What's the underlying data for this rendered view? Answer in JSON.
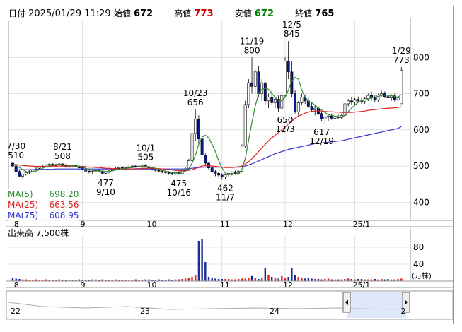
{
  "header": {
    "date_label": "日付",
    "datetime": "2025/01/29 11:29",
    "open_label": "始値",
    "open": "672",
    "high_label": "高値",
    "high": "773",
    "low_label": "安値",
    "low": "672",
    "close_label": "終値",
    "close": "765"
  },
  "colors": {
    "up": "#ffffff",
    "down": "#0a1a8c",
    "candle_outline": "#000000",
    "ma5": "#2e8b2e",
    "ma25": "#e02020",
    "ma75": "#3030d0",
    "vol_up": "#e02020",
    "vol_down": "#1a2a9c",
    "grid": "#cfcfcf"
  },
  "legend": {
    "ma5_label": "MA(5)",
    "ma5_value": "698.20",
    "ma25_label": "MA(25)",
    "ma25_value": "663.56",
    "ma75_label": "MA(75)",
    "ma75_value": "608.95"
  },
  "volume_title": "出来高  7,500株",
  "volume_unit": "(万株)",
  "navigator": {
    "labels": [
      "22",
      "23",
      "24",
      "2"
    ]
  },
  "chart_data": [
    {
      "type": "candlestick",
      "ylim": [
        350,
        900
      ],
      "yticks": [
        400,
        500,
        600,
        700,
        800
      ],
      "x_month_labels": [
        {
          "label": "8",
          "index": 1
        },
        {
          "label": "9",
          "index": 21
        },
        {
          "label": "10",
          "index": 41
        },
        {
          "label": "11",
          "index": 63
        },
        {
          "label": "12",
          "index": 82
        },
        {
          "label": "25/1",
          "index": 103
        }
      ],
      "annotations": [
        {
          "text": [
            "7/30",
            "510"
          ],
          "index": 1,
          "value": 510,
          "pos": "above"
        },
        {
          "text": [
            "8/21",
            "508"
          ],
          "index": 15,
          "value": 508,
          "pos": "above"
        },
        {
          "text": [
            "477",
            "9/10"
          ],
          "index": 28,
          "value": 477,
          "pos": "below"
        },
        {
          "text": [
            "10/1",
            "505"
          ],
          "index": 40,
          "value": 505,
          "pos": "above"
        },
        {
          "text": [
            "10/23",
            "656"
          ],
          "index": 55,
          "value": 656,
          "pos": "above"
        },
        {
          "text": [
            "475",
            "10/16"
          ],
          "index": 50,
          "value": 475,
          "pos": "below"
        },
        {
          "text": [
            "462",
            "11/7"
          ],
          "index": 64,
          "value": 462,
          "pos": "below"
        },
        {
          "text": [
            "11/19",
            "800"
          ],
          "index": 72,
          "value": 800,
          "pos": "above"
        },
        {
          "text": [
            "12/5",
            "845"
          ],
          "index": 84,
          "value": 845,
          "pos": "above"
        },
        {
          "text": [
            "650",
            "12/3"
          ],
          "index": 82,
          "value": 650,
          "pos": "below"
        },
        {
          "text": [
            "617",
            "12/19"
          ],
          "index": 93,
          "value": 617,
          "pos": "below"
        },
        {
          "text": [
            "1/29",
            "773"
          ],
          "index": 117,
          "value": 773,
          "pos": "above"
        }
      ],
      "ohlc": [
        [
          508,
          510,
          498,
          500
        ],
        [
          500,
          502,
          480,
          485
        ],
        [
          485,
          490,
          470,
          472
        ],
        [
          472,
          480,
          465,
          478
        ],
        [
          478,
          485,
          474,
          482
        ],
        [
          482,
          488,
          478,
          485
        ],
        [
          485,
          492,
          482,
          490
        ],
        [
          490,
          496,
          486,
          494
        ],
        [
          494,
          500,
          490,
          498
        ],
        [
          498,
          503,
          494,
          500
        ],
        [
          500,
          505,
          496,
          503
        ],
        [
          503,
          507,
          499,
          505
        ],
        [
          505,
          508,
          500,
          502
        ],
        [
          502,
          506,
          498,
          504
        ],
        [
          504,
          508,
          500,
          506
        ],
        [
          506,
          508,
          500,
          502
        ],
        [
          502,
          505,
          496,
          498
        ],
        [
          498,
          502,
          494,
          500
        ],
        [
          500,
          504,
          496,
          502
        ],
        [
          502,
          505,
          497,
          499
        ],
        [
          499,
          502,
          493,
          495
        ],
        [
          495,
          498,
          488,
          490
        ],
        [
          490,
          494,
          484,
          486
        ],
        [
          486,
          490,
          480,
          484
        ],
        [
          484,
          488,
          479,
          486
        ],
        [
          486,
          490,
          482,
          488
        ],
        [
          488,
          492,
          484,
          486
        ],
        [
          486,
          489,
          477,
          480
        ],
        [
          480,
          486,
          477,
          484
        ],
        [
          484,
          490,
          480,
          488
        ],
        [
          488,
          494,
          484,
          492
        ],
        [
          492,
          496,
          488,
          494
        ],
        [
          494,
          498,
          490,
          496
        ],
        [
          496,
          499,
          492,
          494
        ],
        [
          494,
          498,
          490,
          496
        ],
        [
          496,
          500,
          492,
          498
        ],
        [
          498,
          502,
          494,
          500
        ],
        [
          500,
          503,
          496,
          498
        ],
        [
          498,
          502,
          494,
          500
        ],
        [
          500,
          505,
          496,
          503
        ],
        [
          503,
          505,
          496,
          498
        ],
        [
          498,
          501,
          492,
          494
        ],
        [
          494,
          497,
          488,
          490
        ],
        [
          490,
          494,
          485,
          488
        ],
        [
          488,
          492,
          484,
          486
        ],
        [
          486,
          490,
          480,
          484
        ],
        [
          484,
          488,
          478,
          482
        ],
        [
          482,
          486,
          476,
          480
        ],
        [
          480,
          484,
          475,
          478
        ],
        [
          478,
          484,
          475,
          482
        ],
        [
          482,
          486,
          476,
          479
        ],
        [
          479,
          490,
          477,
          488
        ],
        [
          488,
          496,
          484,
          492
        ],
        [
          492,
          520,
          490,
          515
        ],
        [
          515,
          600,
          510,
          590
        ],
        [
          590,
          656,
          570,
          630
        ],
        [
          630,
          640,
          560,
          575
        ],
        [
          575,
          582,
          520,
          530
        ],
        [
          530,
          535,
          500,
          508
        ],
        [
          508,
          512,
          490,
          495
        ],
        [
          495,
          500,
          480,
          485
        ],
        [
          485,
          490,
          472,
          480
        ],
        [
          480,
          484,
          468,
          475
        ],
        [
          475,
          480,
          462,
          470
        ],
        [
          470,
          478,
          465,
          476
        ],
        [
          476,
          482,
          470,
          480
        ],
        [
          480,
          486,
          474,
          484
        ],
        [
          484,
          488,
          476,
          480
        ],
        [
          480,
          488,
          476,
          486
        ],
        [
          486,
          560,
          484,
          555
        ],
        [
          555,
          680,
          550,
          670
        ],
        [
          670,
          740,
          660,
          730
        ],
        [
          730,
          800,
          700,
          720
        ],
        [
          720,
          770,
          700,
          760
        ],
        [
          760,
          775,
          690,
          700
        ],
        [
          700,
          740,
          680,
          730
        ],
        [
          730,
          735,
          670,
          680
        ],
        [
          680,
          700,
          660,
          690
        ],
        [
          690,
          710,
          670,
          675
        ],
        [
          675,
          690,
          660,
          685
        ],
        [
          685,
          695,
          650,
          660
        ],
        [
          660,
          700,
          655,
          695
        ],
        [
          695,
          800,
          690,
          790
        ],
        [
          790,
          845,
          740,
          760
        ],
        [
          760,
          790,
          690,
          700
        ],
        [
          700,
          710,
          645,
          650
        ],
        [
          650,
          680,
          640,
          675
        ],
        [
          675,
          700,
          668,
          690
        ],
        [
          690,
          698,
          672,
          680
        ],
        [
          680,
          688,
          660,
          665
        ],
        [
          665,
          675,
          650,
          655
        ],
        [
          655,
          670,
          640,
          660
        ],
        [
          660,
          665,
          640,
          645
        ],
        [
          645,
          650,
          625,
          630
        ],
        [
          630,
          640,
          617,
          635
        ],
        [
          635,
          642,
          625,
          638
        ],
        [
          638,
          645,
          628,
          632
        ],
        [
          632,
          640,
          625,
          636
        ],
        [
          636,
          642,
          630,
          634
        ],
        [
          634,
          645,
          630,
          640
        ],
        [
          640,
          680,
          638,
          672
        ],
        [
          672,
          685,
          665,
          680
        ],
        [
          680,
          690,
          670,
          676
        ],
        [
          676,
          688,
          670,
          684
        ],
        [
          684,
          692,
          676,
          680
        ],
        [
          680,
          688,
          672,
          678
        ],
        [
          678,
          690,
          672,
          686
        ],
        [
          686,
          700,
          680,
          695
        ],
        [
          695,
          705,
          680,
          688
        ],
        [
          688,
          696,
          676,
          682
        ],
        [
          682,
          700,
          678,
          696
        ],
        [
          696,
          708,
          690,
          700
        ],
        [
          700,
          706,
          688,
          692
        ],
        [
          692,
          700,
          684,
          688
        ],
        [
          688,
          698,
          680,
          694
        ],
        [
          694,
          700,
          678,
          682
        ],
        [
          682,
          692,
          672,
          688
        ],
        [
          672,
          773,
          672,
          765
        ]
      ],
      "ma5": [
        505,
        502,
        496,
        490,
        485,
        482,
        484,
        486,
        490,
        494,
        498,
        501,
        503,
        504,
        504,
        504,
        503,
        502,
        501,
        500,
        499,
        497,
        494,
        491,
        488,
        487,
        487,
        486,
        485,
        485,
        487,
        489,
        491,
        493,
        494,
        495,
        496,
        497,
        498,
        499,
        499,
        498,
        496,
        494,
        491,
        488,
        486,
        484,
        482,
        481,
        481,
        483,
        486,
        493,
        508,
        530,
        560,
        580,
        585,
        578,
        560,
        540,
        515,
        495,
        480,
        477,
        477,
        478,
        480,
        490,
        520,
        570,
        620,
        665,
        700,
        712,
        715,
        712,
        700,
        690,
        682,
        680,
        690,
        710,
        735,
        745,
        740,
        710,
        690,
        680,
        675,
        668,
        660,
        655,
        648,
        642,
        640,
        638,
        636,
        635,
        640,
        650,
        660,
        668,
        676,
        680,
        682,
        685,
        688,
        690,
        692,
        695,
        696,
        695,
        694,
        692,
        690,
        698
      ],
      "ma25": [
        505,
        504,
        503,
        502,
        501,
        500,
        500,
        499,
        499,
        499,
        499,
        499,
        500,
        500,
        500,
        500,
        500,
        500,
        500,
        500,
        499,
        499,
        498,
        497,
        497,
        496,
        496,
        495,
        494,
        494,
        493,
        493,
        492,
        492,
        492,
        492,
        492,
        493,
        493,
        494,
        494,
        494,
        494,
        493,
        493,
        492,
        491,
        490,
        489,
        488,
        487,
        487,
        487,
        488,
        490,
        493,
        497,
        500,
        501,
        501,
        500,
        499,
        498,
        497,
        496,
        496,
        496,
        497,
        498,
        500,
        505,
        512,
        520,
        530,
        540,
        550,
        560,
        570,
        578,
        585,
        592,
        600,
        608,
        616,
        624,
        632,
        638,
        642,
        646,
        649,
        651,
        652,
        652,
        652,
        651,
        650,
        650,
        649,
        649,
        648,
        648,
        648,
        648,
        649,
        650,
        651,
        652,
        654,
        655,
        656,
        657,
        658,
        659,
        660,
        660,
        661,
        662,
        664
      ],
      "ma75": [
        490,
        490,
        490,
        490,
        490,
        490,
        490,
        491,
        491,
        491,
        491,
        491,
        491,
        492,
        492,
        492,
        492,
        492,
        492,
        492,
        492,
        492,
        492,
        492,
        492,
        492,
        492,
        492,
        492,
        492,
        492,
        492,
        492,
        492,
        492,
        492,
        492,
        492,
        492,
        492,
        492,
        492,
        492,
        492,
        492,
        492,
        492,
        492,
        492,
        492,
        492,
        492,
        492,
        493,
        494,
        495,
        496,
        497,
        497,
        497,
        497,
        497,
        497,
        497,
        497,
        497,
        497,
        497,
        497,
        498,
        500,
        503,
        506,
        510,
        514,
        518,
        522,
        526,
        530,
        534,
        537,
        540,
        543,
        546,
        548,
        550,
        552,
        554,
        556,
        558,
        560,
        562,
        563,
        564,
        565,
        566,
        567,
        568,
        569,
        570,
        572,
        574,
        576,
        578,
        580,
        582,
        584,
        586,
        588,
        590,
        592,
        594,
        596,
        598,
        600,
        602,
        604,
        609
      ]
    },
    {
      "type": "bar",
      "title": "出来高",
      "unit": "(万株)",
      "ylim": [
        0,
        100
      ],
      "yticks": [
        40,
        80
      ],
      "values": [
        8,
        6,
        5,
        4,
        4,
        3,
        3,
        4,
        3,
        3,
        4,
        3,
        3,
        3,
        4,
        3,
        3,
        3,
        3,
        3,
        4,
        3,
        3,
        3,
        4,
        4,
        3,
        4,
        3,
        3,
        3,
        4,
        3,
        3,
        3,
        3,
        3,
        4,
        3,
        3,
        4,
        4,
        3,
        3,
        4,
        3,
        3,
        4,
        3,
        4,
        4,
        5,
        6,
        8,
        10,
        14,
        95,
        100,
        45,
        10,
        8,
        6,
        5,
        5,
        5,
        5,
        4,
        4,
        5,
        6,
        6,
        7,
        12,
        8,
        5,
        8,
        30,
        14,
        10,
        8,
        6,
        12,
        8,
        10,
        30,
        14,
        10,
        8,
        6,
        8,
        6,
        5,
        5,
        4,
        5,
        6,
        4,
        4,
        4,
        4,
        5,
        6,
        5,
        4,
        5,
        5,
        4,
        4,
        4,
        5,
        4,
        5,
        4,
        5,
        4,
        4,
        5,
        6
      ]
    }
  ]
}
